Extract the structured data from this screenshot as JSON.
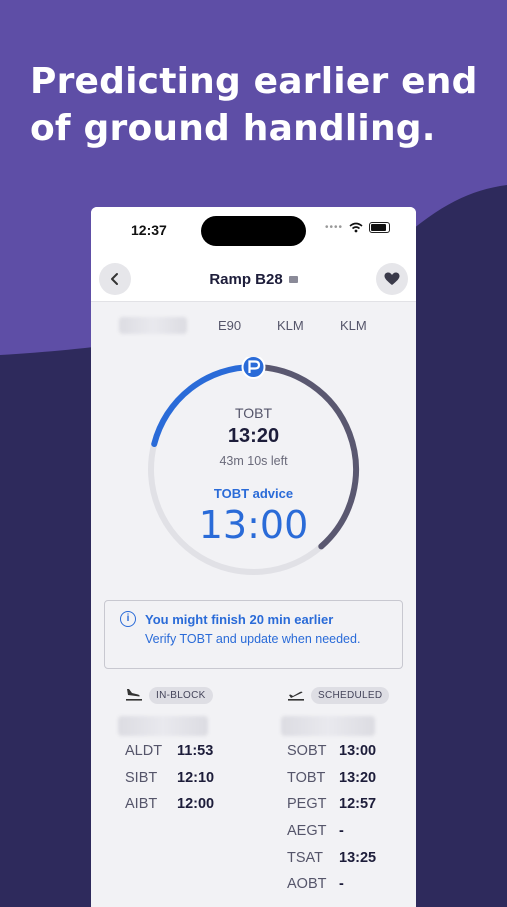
{
  "headline": "Predicting earlier end of ground handling.",
  "colors": {
    "background_top": "#5e4ea6",
    "background_bottom": "#2e2a5c",
    "accent": "#2a6bd8",
    "ring_track": "#5a5870"
  },
  "status_bar": {
    "time": "12:37",
    "signal_icon": "signal-dots-icon",
    "wifi_icon": "wifi-icon",
    "battery_icon": "battery-icon"
  },
  "nav": {
    "back_icon": "chevron-left-icon",
    "title": "Ramp B28",
    "title_icon": "tag-icon",
    "favorite_icon": "heart-icon"
  },
  "flight_info": {
    "aircraft": "E90",
    "operator": "KLM",
    "handler": "KLM"
  },
  "timer": {
    "tobt_label": "TOBT",
    "tobt_value": "13:20",
    "time_left": "43m 10s left",
    "advice_label": "TOBT advice",
    "advice_value": "13:00",
    "progress_fraction": 0.55,
    "marker_icon": "parking-marker-icon"
  },
  "banner": {
    "icon": "info-icon",
    "title": "You might finish 20 min earlier",
    "subtitle": "Verify TOBT and update when needed."
  },
  "arrival": {
    "icon": "plane-landing-icon",
    "status": "IN-BLOCK",
    "rows": [
      {
        "key": "ALDT",
        "value": "11:53"
      },
      {
        "key": "SIBT",
        "value": "12:10"
      },
      {
        "key": "AIBT",
        "value": "12:00"
      }
    ]
  },
  "departure": {
    "icon": "plane-takeoff-icon",
    "status": "SCHEDULED",
    "rows": [
      {
        "key": "SOBT",
        "value": "13:00"
      },
      {
        "key": "TOBT",
        "value": "13:20"
      },
      {
        "key": "PEGT",
        "value": "12:57"
      },
      {
        "key": "AEGT",
        "value": "-"
      },
      {
        "key": "TSAT",
        "value": "13:25"
      },
      {
        "key": "AOBT",
        "value": "-"
      }
    ]
  }
}
